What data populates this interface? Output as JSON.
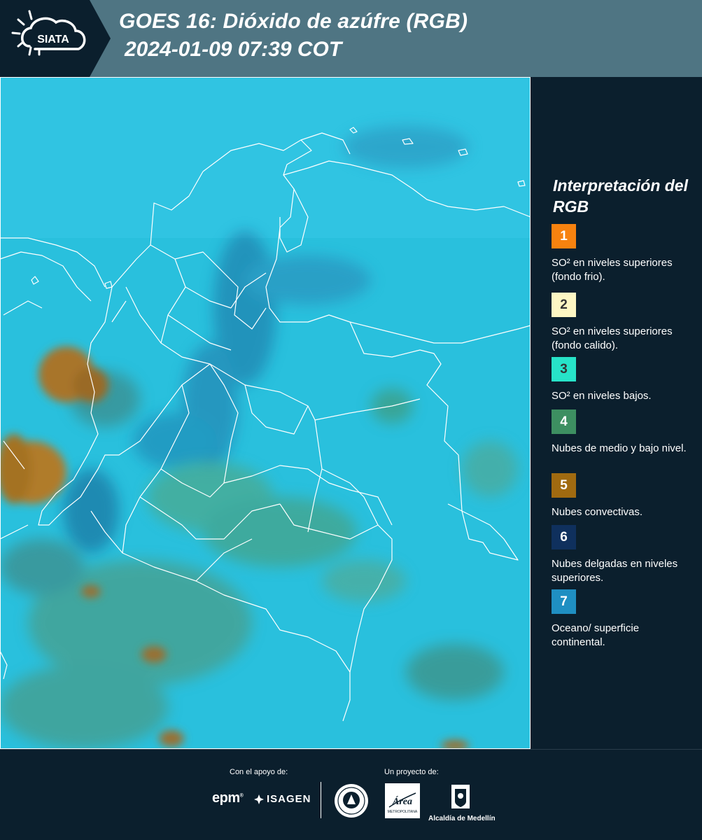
{
  "header": {
    "logo_text": "SIATA",
    "title_line1": "GOES 16: Dióxido de azúfre (RGB)",
    "title_line2": "2024-01-09 07:39 COT"
  },
  "map": {
    "icon": "satellite-map",
    "background_color": "#27bedb",
    "border_color": "#ffffff"
  },
  "legend": {
    "title": "Interpretación del RGB",
    "items": [
      {
        "number": "1",
        "color": "#f7820f",
        "text_color": "#ffffff",
        "label": "SO² en niveles superiores (fondo frio)."
      },
      {
        "number": "2",
        "color": "#fdf6c3",
        "text_color": "#333333",
        "label": "SO² en niveles superiores (fondo calido)."
      },
      {
        "number": "3",
        "color": "#27e3c8",
        "text_color": "#333333",
        "label": "SO² en niveles bajos."
      },
      {
        "number": "4",
        "color": "#3d8f61",
        "text_color": "#ffffff",
        "label": "Nubes de medio y bajo nivel."
      },
      {
        "number": "5",
        "color": "#a06a10",
        "text_color": "#ffffff",
        "label": "Nubes convectivas."
      },
      {
        "number": "6",
        "color": "#0f305d",
        "text_color": "#ffffff",
        "label": "Nubes delgadas en niveles superiores."
      },
      {
        "number": "7",
        "color": "#1f8fc2",
        "text_color": "#ffffff",
        "label": "Oceano/ superficie continental."
      }
    ]
  },
  "footer": {
    "support_label": "Con el apoyo de:",
    "project_label": "Un proyecto de:",
    "epm": "epm",
    "isagen": "ISAGEN",
    "area_text": "Área",
    "area_sub": "METROPOLITANA",
    "alcaldia": "Alcaldía de Medellín"
  }
}
